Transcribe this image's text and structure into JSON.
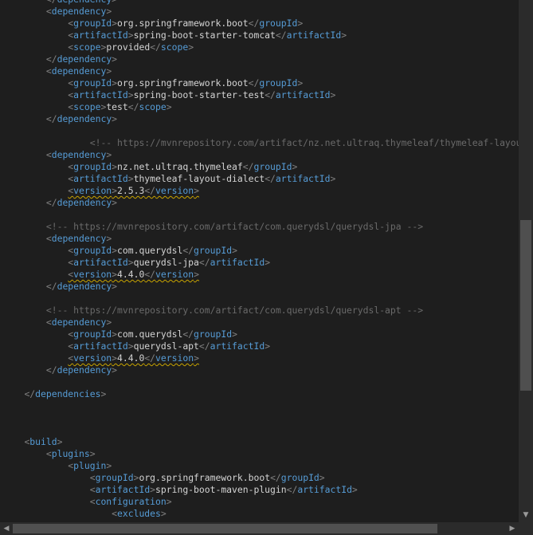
{
  "editor": {
    "lines": [
      {
        "indent": 8,
        "kind": "close",
        "tag": "dependency"
      },
      {
        "indent": 8,
        "kind": "open",
        "tag": "dependency"
      },
      {
        "indent": 12,
        "kind": "elem",
        "tag": "groupId",
        "text": "org.springframework.boot"
      },
      {
        "indent": 12,
        "kind": "elem",
        "tag": "artifactId",
        "text": "spring-boot-starter-tomcat"
      },
      {
        "indent": 12,
        "kind": "elem",
        "tag": "scope",
        "text": "provided"
      },
      {
        "indent": 8,
        "kind": "close",
        "tag": "dependency"
      },
      {
        "indent": 8,
        "kind": "open",
        "tag": "dependency"
      },
      {
        "indent": 12,
        "kind": "elem",
        "tag": "groupId",
        "text": "org.springframework.boot"
      },
      {
        "indent": 12,
        "kind": "elem",
        "tag": "artifactId",
        "text": "spring-boot-starter-test"
      },
      {
        "indent": 12,
        "kind": "elem",
        "tag": "scope",
        "text": "test"
      },
      {
        "indent": 8,
        "kind": "close",
        "tag": "dependency"
      },
      {
        "indent": 0,
        "kind": "blank"
      },
      {
        "indent": 16,
        "kind": "comment",
        "text": "<!-- https://mvnrepository.com/artifact/nz.net.ultraq.thymeleaf/thymeleaf-layout-dialect -->"
      },
      {
        "indent": 8,
        "kind": "open",
        "tag": "dependency"
      },
      {
        "indent": 12,
        "kind": "elem",
        "tag": "groupId",
        "text": "nz.net.ultraq.thymeleaf"
      },
      {
        "indent": 12,
        "kind": "elem",
        "tag": "artifactId",
        "text": "thymeleaf-layout-dialect"
      },
      {
        "indent": 12,
        "kind": "elem",
        "tag": "version",
        "text": "2.5.3",
        "warn": true
      },
      {
        "indent": 8,
        "kind": "close",
        "tag": "dependency"
      },
      {
        "indent": 0,
        "kind": "blank"
      },
      {
        "indent": 8,
        "kind": "comment",
        "text": "<!-- https://mvnrepository.com/artifact/com.querydsl/querydsl-jpa -->"
      },
      {
        "indent": 8,
        "kind": "open",
        "tag": "dependency"
      },
      {
        "indent": 12,
        "kind": "elem",
        "tag": "groupId",
        "text": "com.querydsl"
      },
      {
        "indent": 12,
        "kind": "elem",
        "tag": "artifactId",
        "text": "querydsl-jpa"
      },
      {
        "indent": 12,
        "kind": "elem",
        "tag": "version",
        "text": "4.4.0",
        "warn": true
      },
      {
        "indent": 8,
        "kind": "close",
        "tag": "dependency"
      },
      {
        "indent": 0,
        "kind": "blank"
      },
      {
        "indent": 8,
        "kind": "comment",
        "text": "<!-- https://mvnrepository.com/artifact/com.querydsl/querydsl-apt -->"
      },
      {
        "indent": 8,
        "kind": "open",
        "tag": "dependency"
      },
      {
        "indent": 12,
        "kind": "elem",
        "tag": "groupId",
        "text": "com.querydsl"
      },
      {
        "indent": 12,
        "kind": "elem",
        "tag": "artifactId",
        "text": "querydsl-apt"
      },
      {
        "indent": 12,
        "kind": "elem",
        "tag": "version",
        "text": "4.4.0",
        "warn": true
      },
      {
        "indent": 8,
        "kind": "close",
        "tag": "dependency"
      },
      {
        "indent": 0,
        "kind": "blank"
      },
      {
        "indent": 4,
        "kind": "close",
        "tag": "dependencies"
      },
      {
        "indent": 0,
        "kind": "blank"
      },
      {
        "indent": 0,
        "kind": "blank"
      },
      {
        "indent": 0,
        "kind": "blank"
      },
      {
        "indent": 4,
        "kind": "open",
        "tag": "build"
      },
      {
        "indent": 8,
        "kind": "open",
        "tag": "plugins"
      },
      {
        "indent": 12,
        "kind": "open",
        "tag": "plugin"
      },
      {
        "indent": 16,
        "kind": "elem",
        "tag": "groupId",
        "text": "org.springframework.boot"
      },
      {
        "indent": 16,
        "kind": "elem",
        "tag": "artifactId",
        "text": "spring-boot-maven-plugin"
      },
      {
        "indent": 16,
        "kind": "open",
        "tag": "configuration"
      },
      {
        "indent": 20,
        "kind": "open",
        "tag": "excludes"
      }
    ]
  },
  "scrollbars": {
    "vertical_icon": "arrow-down-icon",
    "horizontal_left_icon": "arrow-left-icon",
    "horizontal_right_icon": "arrow-right-icon"
  },
  "colors": {
    "background": "#1e1e1e",
    "tag": "#569cd6",
    "bracket": "#808080",
    "text": "#d4d4d4",
    "comment": "#6a6a6a",
    "warning_underline": "#c8a400"
  }
}
